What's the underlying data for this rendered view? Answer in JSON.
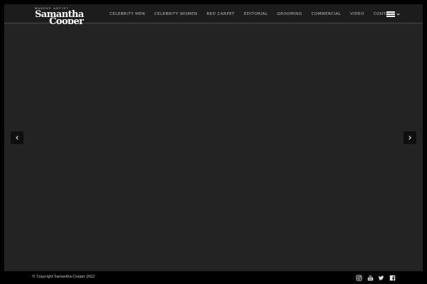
{
  "brand": {
    "tagline": "Makeup Artist",
    "name_line1": "Samantha",
    "name_line2": "Cooper"
  },
  "nav": {
    "items": [
      {
        "label": "CELEBRITY MEN"
      },
      {
        "label": "CELEBRITY WOMEN"
      },
      {
        "label": "RED CARPET"
      },
      {
        "label": "EDITORIAL"
      },
      {
        "label": "GROOMING"
      },
      {
        "label": "COMMERCIAL"
      },
      {
        "label": "VIDEO"
      },
      {
        "label": "CONTACT"
      }
    ],
    "menu_icon": "hamburger-icon"
  },
  "slider": {
    "prev_icon": "chevron-left-icon",
    "next_icon": "chevron-right-icon"
  },
  "footer": {
    "copyright": "© Copyright Samantha Cooper 2022",
    "social": [
      "instagram-icon",
      "youtube-icon",
      "twitter-icon",
      "facebook-icon"
    ]
  },
  "colors": {
    "page_bg": "#000000",
    "frame_bg": "#232323",
    "header_bg": "#1c1c1c",
    "text": "#bdbdbd",
    "white": "#ffffff"
  }
}
